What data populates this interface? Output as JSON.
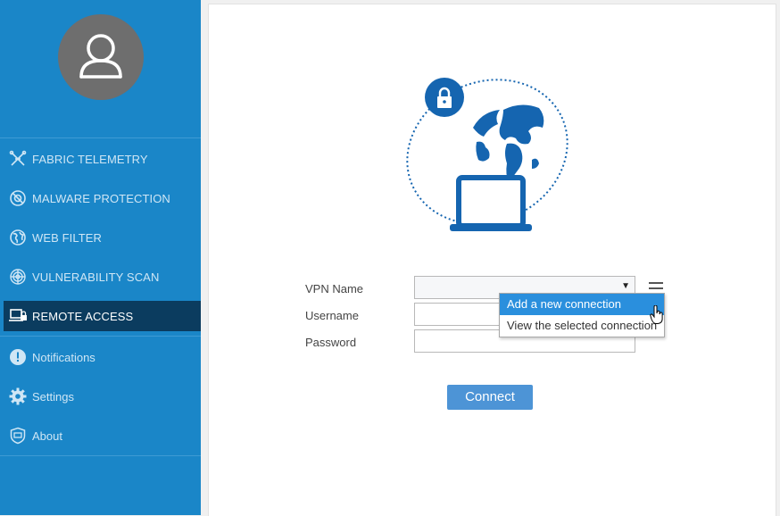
{
  "sidebar": {
    "items": [
      {
        "label": "FABRIC TELEMETRY",
        "icon": "fabric-telemetry-icon"
      },
      {
        "label": "MALWARE PROTECTION",
        "icon": "malware-protection-icon"
      },
      {
        "label": "WEB FILTER",
        "icon": "web-filter-icon"
      },
      {
        "label": "VULNERABILITY SCAN",
        "icon": "vulnerability-scan-icon"
      },
      {
        "label": "REMOTE ACCESS",
        "icon": "remote-access-icon",
        "active": true
      },
      {
        "label": "Notifications",
        "icon": "notifications-icon"
      },
      {
        "label": "Settings",
        "icon": "settings-icon"
      },
      {
        "label": "About",
        "icon": "about-icon"
      }
    ]
  },
  "form": {
    "vpn_name_label": "VPN Name",
    "username_label": "Username",
    "password_label": "Password",
    "vpn_name_value": "",
    "username_value": "",
    "password_value": ""
  },
  "dropdown": {
    "items": [
      "Add a new connection",
      "View the selected connection"
    ],
    "highlighted": 0
  },
  "connect_label": "Connect",
  "colors": {
    "sidebar_bg": "#1a86c8",
    "active_bg": "#0b3c5f",
    "accent": "#1565b0",
    "button": "#4d94d6"
  }
}
